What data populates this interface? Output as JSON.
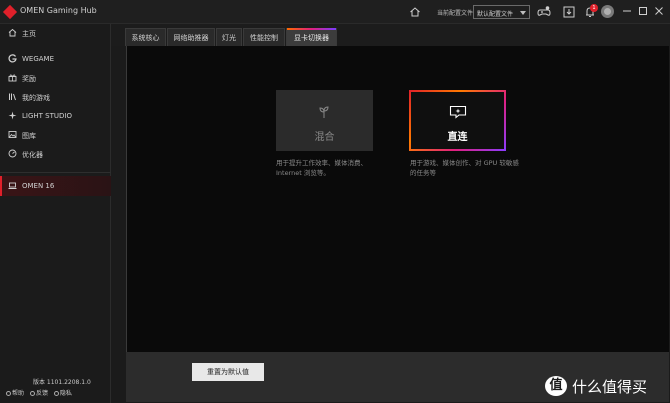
{
  "app": {
    "title": "OMEN Gaming Hub"
  },
  "titlebar": {
    "profile_label": "当前配置文件",
    "profile_value": "默认配置文件",
    "notification_count": "1"
  },
  "sidebar": {
    "items": [
      {
        "label": "主页",
        "icon": "home-icon"
      },
      {
        "label": "WEGAME",
        "icon": "wegame-icon"
      },
      {
        "label": "奖励",
        "icon": "gift-icon"
      },
      {
        "label": "我的游戏",
        "icon": "library-icon"
      },
      {
        "label": "LIGHT STUDIO",
        "icon": "sparkle-icon"
      },
      {
        "label": "图库",
        "icon": "gallery-icon"
      },
      {
        "label": "优化器",
        "icon": "optimizer-icon"
      }
    ],
    "device": {
      "label": "OMEN 16",
      "icon": "laptop-icon"
    },
    "version": "版本 1101.2208.1.0",
    "footer": [
      "帮助",
      "反馈",
      "隐私"
    ]
  },
  "tabs": [
    {
      "label": "系统核心",
      "active": false
    },
    {
      "label": "网络助推器",
      "active": false
    },
    {
      "label": "灯光",
      "active": false
    },
    {
      "label": "性能控制",
      "active": false
    },
    {
      "label": "显卡切换器",
      "active": true
    }
  ],
  "modes": {
    "mixed": {
      "label": "混合",
      "desc": "用于提升工作效率、媒体消费、Internet 浏览等。",
      "selected": false
    },
    "direct": {
      "label": "直连",
      "desc": "用于游戏、媒体创作、对 GPU 较敏感的任务等",
      "selected": true
    }
  },
  "reset_button": "重置为默认值",
  "watermark": {
    "badge": "值",
    "text": "什么值得买"
  },
  "colors": {
    "accent": "#e0202a",
    "background": "#0a0a0a",
    "sidebar": "#1b1b1b"
  }
}
